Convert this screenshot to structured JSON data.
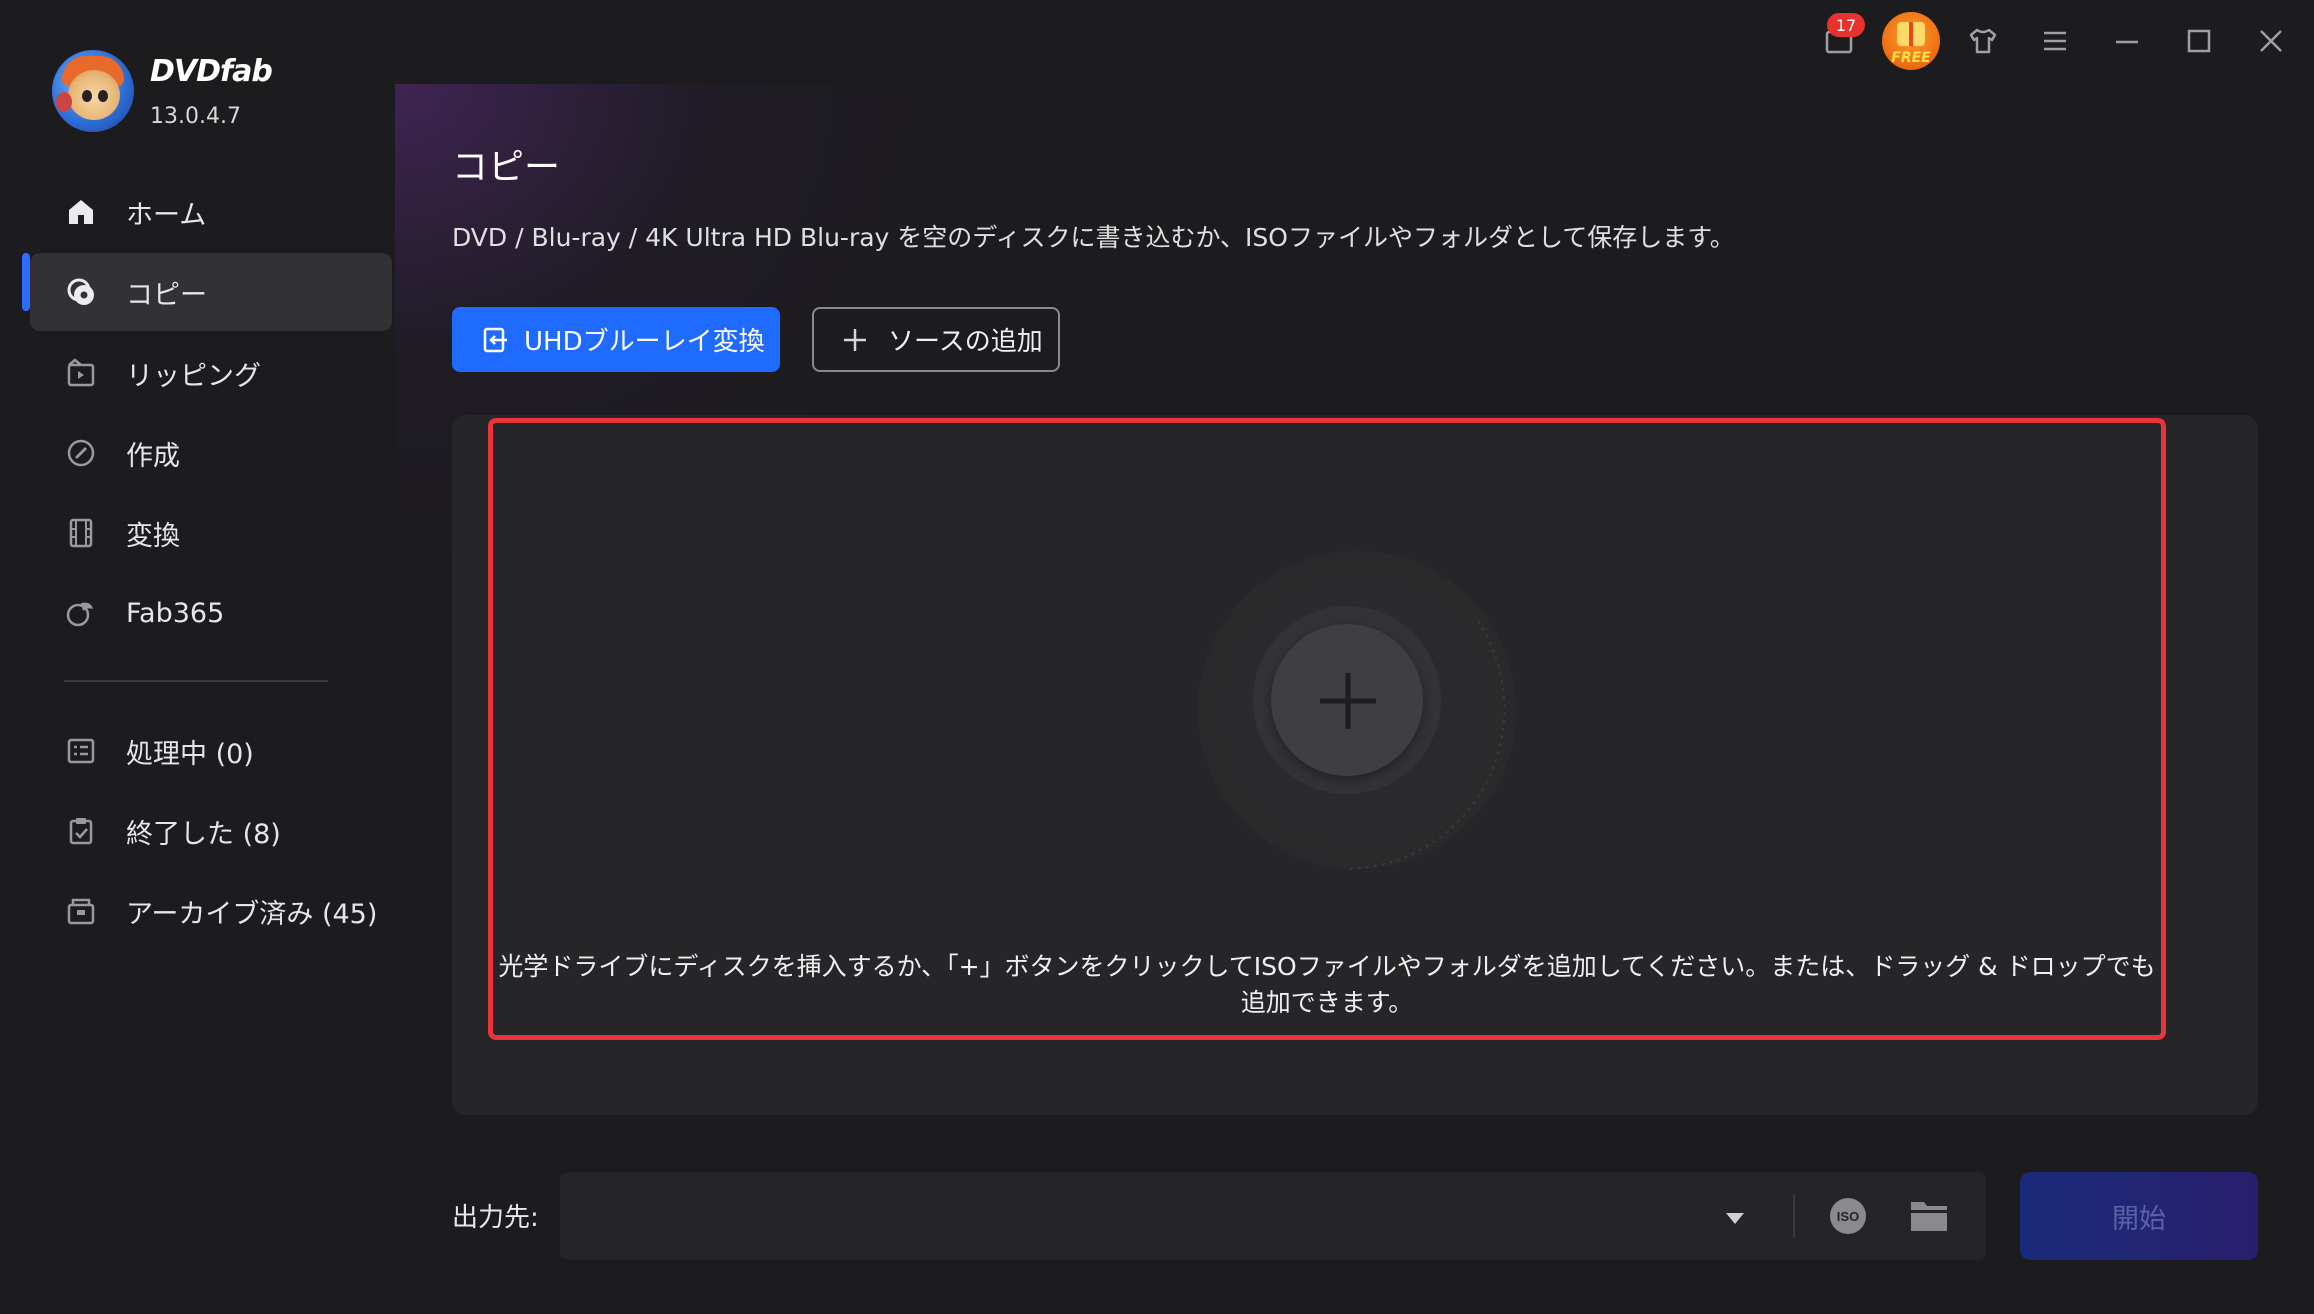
{
  "app": {
    "brand": "DVDfab",
    "version": "13.0.4.7"
  },
  "topbar": {
    "notification_count": "17",
    "free_label": "FREE"
  },
  "sidebar": {
    "items": [
      {
        "label": "ホーム",
        "icon": "home-icon"
      },
      {
        "label": "コピー",
        "icon": "copy-disc-icon",
        "active": true
      },
      {
        "label": "リッピング",
        "icon": "ripping-icon"
      },
      {
        "label": "作成",
        "icon": "create-icon"
      },
      {
        "label": "変換",
        "icon": "film-icon"
      },
      {
        "label": "Fab365",
        "icon": "fab365-icon"
      }
    ],
    "task_items": [
      {
        "label": "処理中 (0)",
        "icon": "processing-list-icon"
      },
      {
        "label": "終了した (8)",
        "icon": "finished-clipboard-icon"
      },
      {
        "label": "アーカイブ済み (45)",
        "icon": "archive-box-icon"
      }
    ]
  },
  "main": {
    "title": "コピー",
    "description": "DVD / Blu-ray / 4K Ultra HD Blu-ray を空のディスクに書き込むか、ISOファイルやフォルダとして保存します。",
    "uhd_button": "UHDブルーレイ変換",
    "add_source_button": "ソースの追加",
    "drop_hint": "光学ドライブにディスクを挿入するか、「+」ボタンをクリックしてISOファイルやフォルダを追加してください。または、ドラッグ & ドロップでも追加できます。",
    "output_label": "出力先:",
    "output_value": "",
    "start_button": "開始"
  },
  "colors": {
    "accent": "#1f6bff",
    "highlight": "#e8343a",
    "badge": "#e8322d"
  }
}
